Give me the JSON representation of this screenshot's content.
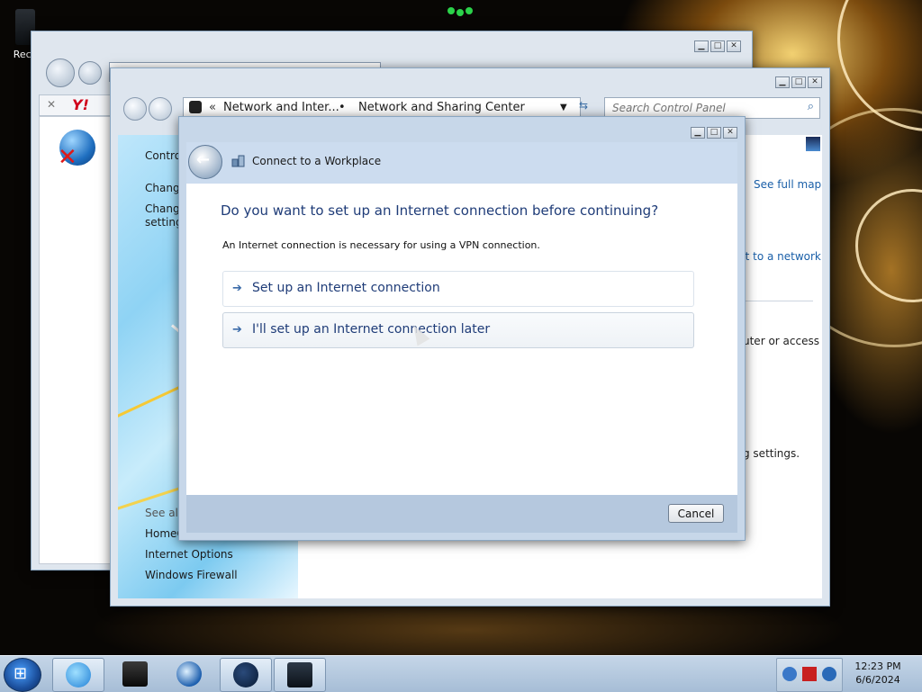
{
  "desktop": {
    "recycle_label": "Recy"
  },
  "ie_window": {
    "controls": [
      "▁",
      "□",
      "✕"
    ],
    "tab_close": "✕",
    "yahoo_logo": "Y!"
  },
  "control_panel": {
    "controls": [
      "▁",
      "□",
      "✕"
    ],
    "breadcrumb": {
      "root_icon": "chevron-double-left",
      "item1": "Network and Inter...",
      "separator": "•",
      "item2": "Network and Sharing Center"
    },
    "search_placeholder": "Search Control Panel",
    "left_pane": {
      "links": [
        "Contro",
        "Change",
        "Change",
        "setting"
      ],
      "see_also": "See also",
      "bottom_links": [
        "HomeG",
        "Internet Options",
        "Windows Firewall"
      ]
    },
    "main_pane": {
      "see_full_map": "See full map",
      "connect_to_network": "ct to a network",
      "router_text": "uter or access",
      "settings_text": "g settings."
    }
  },
  "dialog": {
    "controls": [
      "▁",
      "□",
      "✕"
    ],
    "title": "Connect to a Workplace",
    "question": "Do you want to set up an Internet connection before continuing?",
    "info": "An Internet connection is necessary for using a VPN connection.",
    "options": [
      {
        "label": "Set up an Internet connection"
      },
      {
        "label": "I'll set up an Internet connection later"
      }
    ],
    "cancel_label": "Cancel"
  },
  "taskbar": {
    "time": "12:23 PM",
    "date": "6/6/2024",
    "apps": [
      "internet-explorer",
      "terminal",
      "media-player",
      "network",
      "control-panel"
    ]
  },
  "colors": {
    "link_blue": "#1f3c78",
    "accent": "#3a6aa8",
    "taskbar": "#b7cbe1"
  }
}
